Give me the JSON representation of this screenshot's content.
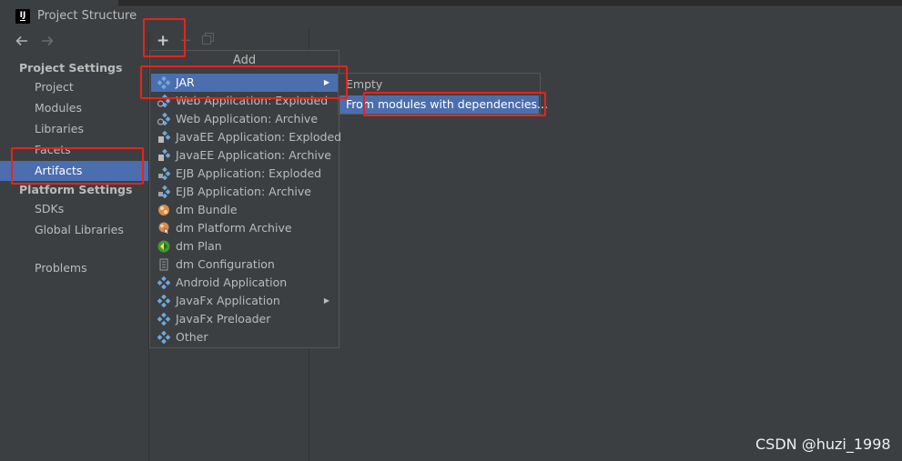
{
  "window": {
    "title": "Project Structure",
    "logo_text": "IJ"
  },
  "nav": {
    "back_icon": "arrow-left-icon",
    "forward_icon": "arrow-right-icon"
  },
  "sidebar": {
    "project_settings_header": "Project Settings",
    "project_settings_items": [
      {
        "label": "Project"
      },
      {
        "label": "Modules"
      },
      {
        "label": "Libraries"
      },
      {
        "label": "Facets"
      },
      {
        "label": "Artifacts",
        "selected": true
      }
    ],
    "platform_settings_header": "Platform Settings",
    "platform_settings_items": [
      {
        "label": "SDKs"
      },
      {
        "label": "Global Libraries"
      }
    ],
    "problems_label": "Problems"
  },
  "toolbar": {
    "add_symbol": "+",
    "remove_symbol": "−",
    "copy_icon": "copy-icon"
  },
  "add_popup": {
    "title": "Add",
    "items": [
      {
        "label": "JAR",
        "icon": "artifact-icon",
        "selected": true,
        "submenu": true
      },
      {
        "label": "Web Application: Exploded",
        "icon": "web-artifact-icon"
      },
      {
        "label": "Web Application: Archive",
        "icon": "web-artifact-icon"
      },
      {
        "label": "JavaEE Application: Exploded",
        "icon": "javaee-artifact-icon"
      },
      {
        "label": "JavaEE Application: Archive",
        "icon": "javaee-artifact-icon"
      },
      {
        "label": "EJB Application: Exploded",
        "icon": "ejb-artifact-icon"
      },
      {
        "label": "EJB Application: Archive",
        "icon": "ejb-artifact-icon"
      },
      {
        "label": "dm Bundle",
        "icon": "dm-bundle-icon"
      },
      {
        "label": "dm Platform Archive",
        "icon": "dm-platform-icon"
      },
      {
        "label": "dm Plan",
        "icon": "dm-plan-icon"
      },
      {
        "label": "dm Configuration",
        "icon": "dm-configuration-icon"
      },
      {
        "label": "Android Application",
        "icon": "artifact-icon"
      },
      {
        "label": "JavaFx Application",
        "icon": "artifact-icon",
        "submenu": true
      },
      {
        "label": "JavaFx Preloader",
        "icon": "artifact-icon"
      },
      {
        "label": "Other",
        "icon": "artifact-icon"
      }
    ]
  },
  "jar_submenu": {
    "items": [
      {
        "label": "Empty"
      },
      {
        "label": "From modules with dependencies...",
        "selected": true
      }
    ]
  },
  "colors": {
    "background": "#3c3f41",
    "selection": "#4b6eaf",
    "highlight_box": "#e8231c"
  },
  "watermark": "CSDN @huzi_1998"
}
